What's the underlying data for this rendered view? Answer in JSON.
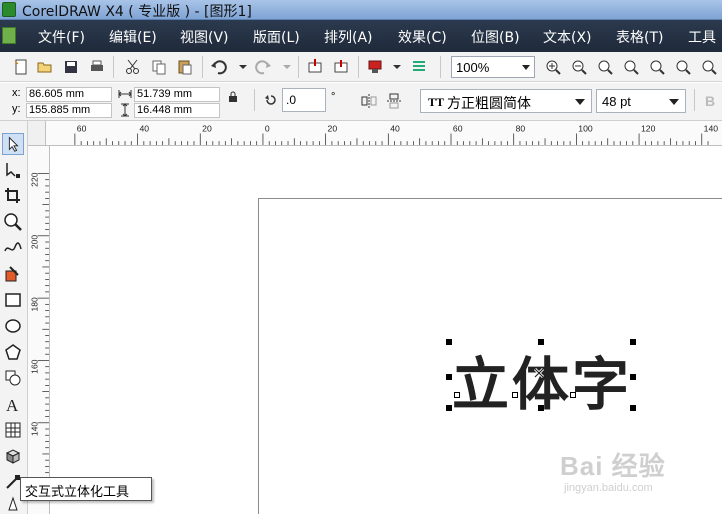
{
  "window": {
    "title": "CorelDRAW X4 ( 专业版 ) - [图形1]"
  },
  "menu": [
    "文件(F)",
    "编辑(E)",
    "视图(V)",
    "版面(L)",
    "排列(A)",
    "效果(C)",
    "位图(B)",
    "文本(X)",
    "表格(T)",
    "工具"
  ],
  "toolbar": {
    "zoom": "100%"
  },
  "propbar": {
    "x_label": "x:",
    "x_value": "86.605 mm",
    "y_label": "y:",
    "y_value": "155.885 mm",
    "w_value": "51.739 mm",
    "h_value": "16.448 mm",
    "angle_value": ".0",
    "angle_unit": "°",
    "font_name": "方正粗圆简体",
    "font_size": "48 pt"
  },
  "rulers": {
    "h_ticks": [
      "60",
      "40",
      "20",
      "0",
      "20",
      "40",
      "60",
      "80",
      "100",
      "120",
      "140"
    ],
    "v_ticks": [
      "220",
      "200",
      "180",
      "160",
      "140"
    ]
  },
  "canvas": {
    "art_text": "立体字"
  },
  "tooltip": "交互式立体化工具",
  "watermark": {
    "main": "Bai 经验",
    "sub": "jingyan.baidu.com"
  },
  "colors": {
    "menubar": "#1f2a3a",
    "titlebar": "#7fa3d4",
    "text": "#222222"
  }
}
